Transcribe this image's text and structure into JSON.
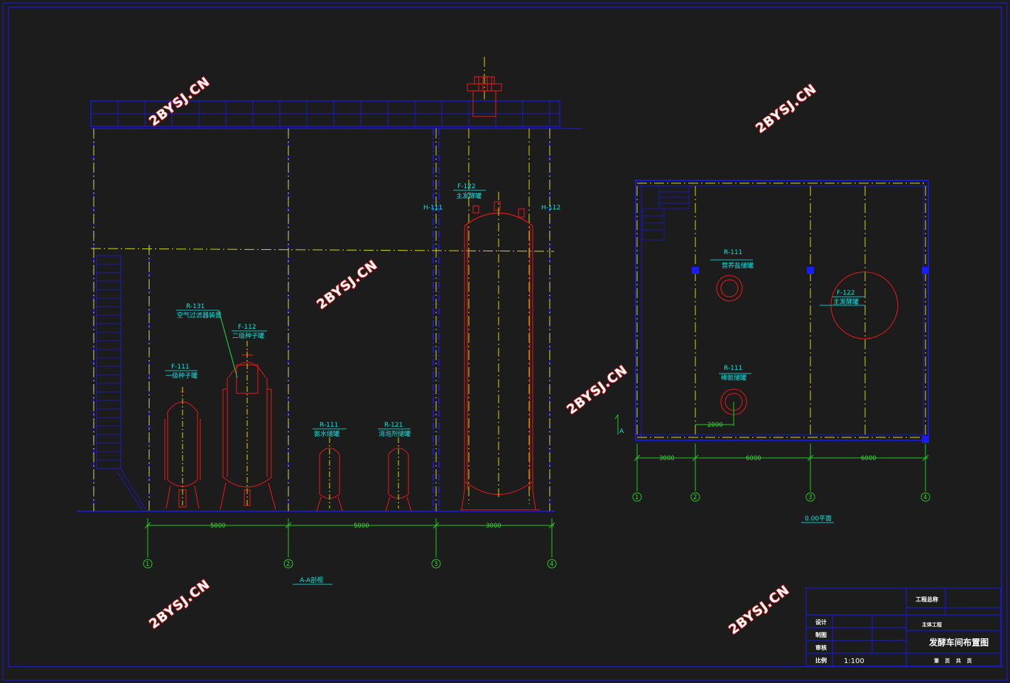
{
  "section_view": {
    "title": "A-A剖视",
    "labels": {
      "h111": "H-111",
      "h112": "H-112",
      "f122_code": "F-122",
      "f122_name": "主发酵罐",
      "r131_code": "R-131",
      "r131_name": "空气过滤器装置",
      "f112_code": "F-112",
      "f112_name": "二级种子罐",
      "f111_code": "F-111",
      "f111_name": "一级种子罐",
      "r111_code": "R-111",
      "r111_name": "氨水储罐",
      "r121_code": "R-121",
      "r121_name": "消泡剂储罐"
    },
    "dimensions": [
      "5000",
      "5000",
      "3000"
    ],
    "axes": [
      "1",
      "2",
      "3",
      "4"
    ]
  },
  "plan_view": {
    "title": "0.00平面",
    "labels": {
      "r111a_code": "R-111",
      "r111a_name": "营养盐储罐",
      "f122_code": "F-122",
      "f122_name": "主发酵罐",
      "r111b_code": "R-111",
      "r111b_name": "稀氨储罐",
      "dim_2000": "2000",
      "marker_a": "A"
    },
    "dimensions": [
      "3000",
      "6000",
      "6000"
    ],
    "axes": [
      "1",
      "2",
      "3",
      "4"
    ]
  },
  "title_block": {
    "project_name": "工程总称",
    "sub_project": "主体工程",
    "drawing_title": "发酵车间布置图",
    "designer": "设计",
    "drafter": "制图",
    "reviewer": "审核",
    "scale_label": "比例",
    "scale_value": "1:100",
    "sheet_info": "第 页 共 页"
  },
  "watermark": "2BYSJ.CN",
  "colors": {
    "background": "#1c1c1c",
    "structure": "#1a1acd",
    "center_lines": "#d9d900",
    "equipment": "#e01818",
    "dimensions": "#22cc22",
    "labels": "#00e6e6"
  }
}
